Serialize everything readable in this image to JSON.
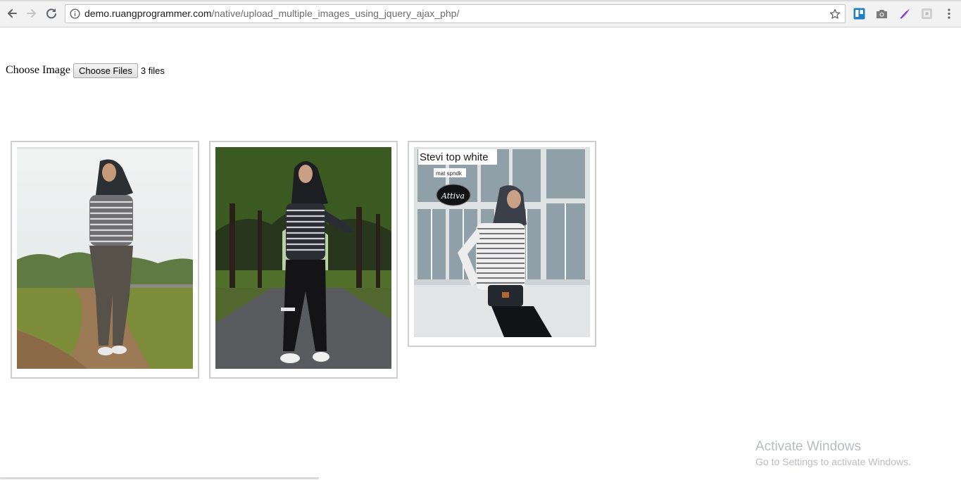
{
  "browser": {
    "url_host": "demo.ruangprogrammer.com",
    "url_path": "/native/upload_multiple_images_using_jquery_ajax_php/",
    "icons": [
      "back-icon",
      "forward-icon",
      "reload-icon",
      "info-icon",
      "star-icon",
      "trello-icon",
      "camera-icon",
      "feather-icon",
      "extension-icon",
      "menu-icon"
    ]
  },
  "upload": {
    "label": "Choose Image",
    "button_label": "Choose Files",
    "status": "3 files"
  },
  "images": [
    {
      "caption": "",
      "badge": ""
    },
    {
      "caption": "",
      "badge": ""
    },
    {
      "caption": "Stevi top white",
      "badge": "mat spndk",
      "logo": "Attiva"
    }
  ],
  "watermark": {
    "title": "Activate Windows",
    "subtitle": "Go to Settings to activate Windows."
  }
}
